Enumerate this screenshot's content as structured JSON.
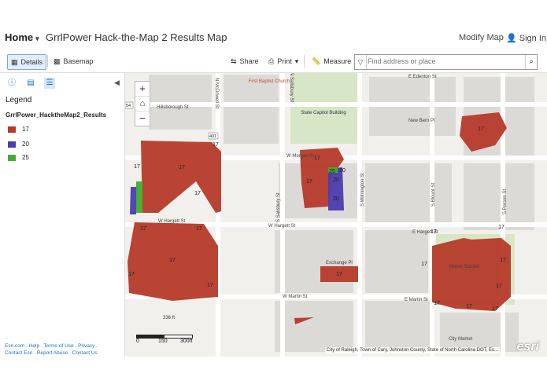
{
  "header": {
    "home_label": "Home",
    "title": "GrrlPower Hack-the-Map 2 Results Map",
    "modify_label": "Modify Map",
    "signin_label": "Sign In"
  },
  "toolbar": {
    "details_label": "Details",
    "basemap_label": "Basemap",
    "share_label": "Share",
    "print_label": "Print",
    "measure_label": "Measure",
    "search_placeholder": "Find address or place"
  },
  "sidebar": {
    "legend_heading": "Legend",
    "layer_name": "GrrlPower_HacktheMap2_Results",
    "legend_items": [
      {
        "label": "17",
        "color": "#b53a2a"
      },
      {
        "label": "20",
        "color": "#4b3cae"
      },
      {
        "label": "25",
        "color": "#3fae2a"
      }
    ],
    "footer_line1": "Esri.com . Help . Terms of Use . Privacy .",
    "footer_line2": "Contact Esri . Report Abuse . Contact Us"
  },
  "map": {
    "streets": [
      "N McDowell St",
      "N Salisbury St",
      "E Edenton St",
      "Hillsborough St",
      "New Bern Pl",
      "W Morgan St",
      "W Hargett St",
      "W Hargett St",
      "E Hargett St",
      "Exchange Pl",
      "W Martin St",
      "E Martin St",
      "City Market",
      "S Salisbury St",
      "S Wilmington St",
      "S Blount St",
      "S Person St",
      "Moore Square"
    ],
    "places": [
      "First Baptist Church",
      "State Capitol Building"
    ],
    "shields": [
      "54",
      "401"
    ],
    "spot_elevation": "336 ft",
    "scale_labels": [
      "0",
      "150",
      "300ft"
    ],
    "attribution": "City of Raleigh, Town of Cary, Johnston County, State of North Carolina DOT, Es...",
    "esri_logo": "esri",
    "polygon_labels": [
      "17",
      "17",
      "17",
      "17",
      "17",
      "17",
      "17",
      "17",
      "17",
      "17",
      "17",
      "17",
      "17",
      "17",
      "17",
      "20",
      "20",
      "20",
      "25",
      "17",
      "17",
      "17",
      "17",
      "17",
      "17",
      "17"
    ]
  }
}
